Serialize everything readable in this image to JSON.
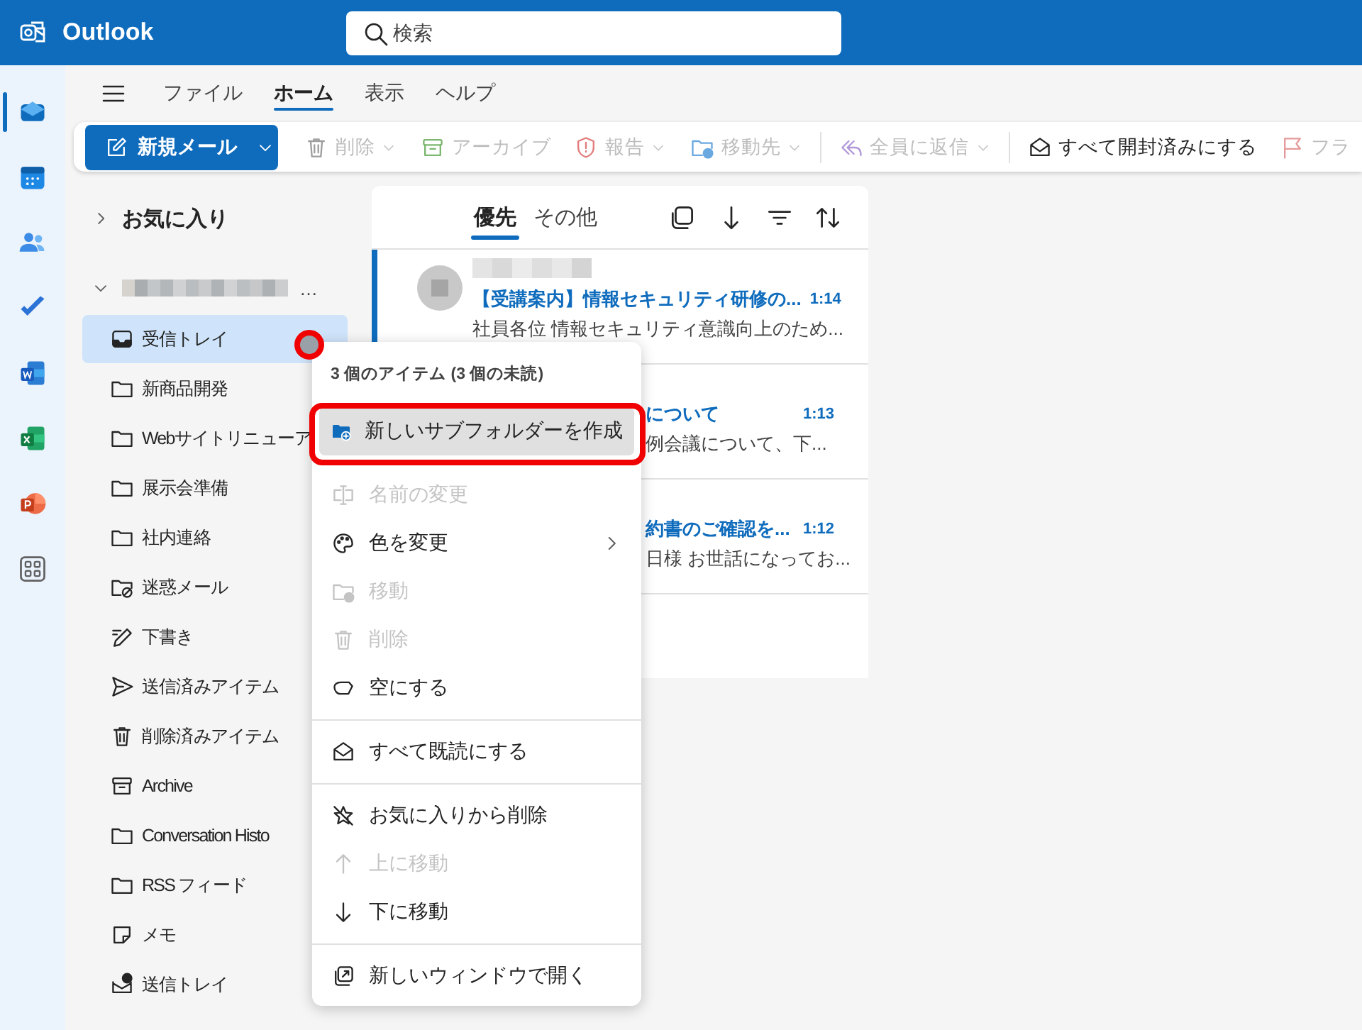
{
  "app": {
    "title": "Outlook"
  },
  "search": {
    "placeholder": "検索"
  },
  "rail": [
    {
      "selected": true
    },
    {
      "selected": false
    },
    {
      "selected": false
    },
    {
      "selected": false
    },
    {
      "selected": false
    },
    {
      "selected": false
    },
    {
      "selected": false
    },
    {
      "selected": false
    }
  ],
  "menu_tabs": [
    {
      "label": "ファイル",
      "selected": false
    },
    {
      "label": "ホーム",
      "selected": true
    },
    {
      "label": "表示",
      "selected": false
    },
    {
      "label": "ヘルプ",
      "selected": false
    }
  ],
  "ribbon": {
    "new_mail": "新規メール",
    "actions": [
      {
        "kind": "action",
        "label": "削除",
        "disabled": true,
        "dropdown": true
      },
      {
        "kind": "action",
        "label": "アーカイブ",
        "disabled": true,
        "dropdown": false
      },
      {
        "kind": "action",
        "label": "報告",
        "disabled": true,
        "dropdown": true
      },
      {
        "kind": "action",
        "label": "移動先",
        "disabled": true,
        "dropdown": true
      },
      {
        "kind": "separator"
      },
      {
        "kind": "action",
        "label": "全員に返信",
        "disabled": true,
        "dropdown": true
      },
      {
        "kind": "separator"
      },
      {
        "kind": "action",
        "label": "すべて開封済みにする",
        "disabled": false,
        "dropdown": false
      },
      {
        "kind": "action",
        "label": "フラ",
        "disabled": true,
        "dropdown": false
      }
    ]
  },
  "favorites": {
    "label": "お気に入り",
    "expanded": false
  },
  "account": {
    "name": "…",
    "expanded": true
  },
  "folders": [
    {
      "name": "受信トレイ",
      "selected": true
    },
    {
      "name": "新商品開発",
      "selected": false
    },
    {
      "name": "Webサイトリニューア",
      "selected": false
    },
    {
      "name": "展示会準備",
      "selected": false
    },
    {
      "name": "社内連絡",
      "selected": false
    },
    {
      "name": "迷惑メール",
      "selected": false
    },
    {
      "name": "下書き",
      "selected": false
    },
    {
      "name": "送信済みアイテム",
      "selected": false
    },
    {
      "name": "削除済みアイテム",
      "selected": false
    },
    {
      "name": "Archive",
      "selected": false
    },
    {
      "name": "Conversation Histo",
      "selected": false
    },
    {
      "name": "RSS フィード",
      "selected": false
    },
    {
      "name": "メモ",
      "selected": false
    },
    {
      "name": "送信トレイ",
      "selected": false
    }
  ],
  "message_tabs": [
    {
      "label": "優先",
      "selected": true
    },
    {
      "label": "その他",
      "selected": false
    }
  ],
  "messages": [
    {
      "unread": true,
      "covered": false,
      "subject": "【受講案内】情報セキュリティ研修の...",
      "time": "1:14",
      "preview": "社員各位 情報セキュリティ意識向上のため..."
    },
    {
      "unread": true,
      "covered": true,
      "subject": "について",
      "time": "1:13",
      "preview": "例会議について、下..."
    },
    {
      "unread": true,
      "covered": true,
      "subject": "約書のご確認を...",
      "time": "1:12",
      "preview": "日様 お世話になってお..."
    }
  ],
  "context_menu": {
    "header": "3 個のアイテム (3 個の未読)",
    "items": [
      {
        "kind": "item",
        "label": "新しいサブフォルダーを作成",
        "disabled": false,
        "selected": true,
        "submenu": false
      },
      {
        "kind": "item",
        "label": "名前の変更",
        "disabled": true,
        "selected": false,
        "submenu": false
      },
      {
        "kind": "item",
        "label": "色を変更",
        "disabled": false,
        "selected": false,
        "submenu": true
      },
      {
        "kind": "item",
        "label": "移動",
        "disabled": true,
        "selected": false,
        "submenu": false
      },
      {
        "kind": "item",
        "label": "削除",
        "disabled": true,
        "selected": false,
        "submenu": false
      },
      {
        "kind": "item",
        "label": "空にする",
        "disabled": false,
        "selected": false,
        "submenu": false
      },
      {
        "kind": "separator"
      },
      {
        "kind": "item",
        "label": "すべて既読にする",
        "disabled": false,
        "selected": false,
        "submenu": false
      },
      {
        "kind": "separator"
      },
      {
        "kind": "item",
        "label": "お気に入りから削除",
        "disabled": false,
        "selected": false,
        "submenu": false
      },
      {
        "kind": "item",
        "label": "上に移動",
        "disabled": true,
        "selected": false,
        "submenu": false
      },
      {
        "kind": "item",
        "label": "下に移動",
        "disabled": false,
        "selected": false,
        "submenu": false
      },
      {
        "kind": "separator"
      },
      {
        "kind": "item",
        "label": "新しいウィンドウで開く",
        "disabled": false,
        "selected": false,
        "submenu": false
      }
    ]
  }
}
